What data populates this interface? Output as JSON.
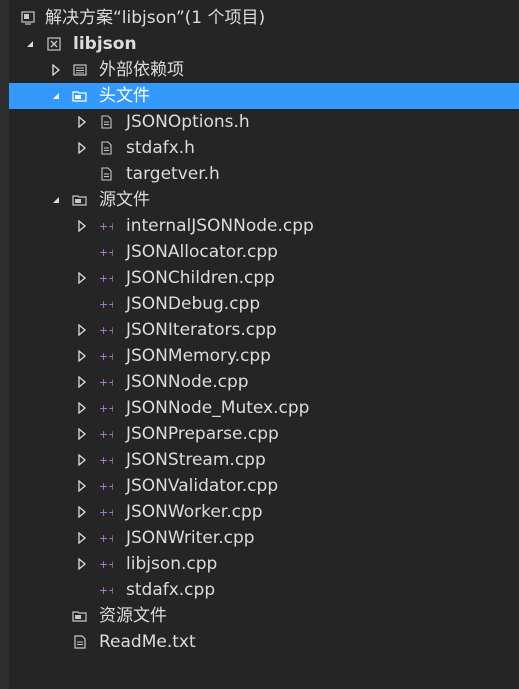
{
  "solution": {
    "label": "解决方案“libjson”(1 个项目)",
    "icon": "solution-icon"
  },
  "project": {
    "label": "libjson",
    "icon": "project-icon",
    "expanded": true
  },
  "external_deps": {
    "label": "外部依赖项",
    "icon": "external-deps-icon",
    "expanded": false
  },
  "header_folder": {
    "label": "头文件",
    "icon": "filter-folder-icon",
    "expanded": true,
    "selected": true,
    "files": [
      {
        "name": "JSONOptions.h",
        "expandable": true,
        "icon": "header-file-icon"
      },
      {
        "name": "stdafx.h",
        "expandable": true,
        "icon": "header-file-icon"
      },
      {
        "name": "targetver.h",
        "expandable": false,
        "icon": "header-file-icon"
      }
    ]
  },
  "source_folder": {
    "label": "源文件",
    "icon": "filter-folder-icon",
    "expanded": true,
    "files": [
      {
        "name": "internalJSONNode.cpp",
        "expandable": true,
        "icon": "cpp-file-icon"
      },
      {
        "name": "JSONAllocator.cpp",
        "expandable": false,
        "icon": "cpp-file-icon"
      },
      {
        "name": "JSONChildren.cpp",
        "expandable": true,
        "icon": "cpp-file-icon"
      },
      {
        "name": "JSONDebug.cpp",
        "expandable": false,
        "icon": "cpp-file-icon"
      },
      {
        "name": "JSONIterators.cpp",
        "expandable": true,
        "icon": "cpp-file-icon"
      },
      {
        "name": "JSONMemory.cpp",
        "expandable": true,
        "icon": "cpp-file-icon"
      },
      {
        "name": "JSONNode.cpp",
        "expandable": true,
        "icon": "cpp-file-icon"
      },
      {
        "name": "JSONNode_Mutex.cpp",
        "expandable": true,
        "icon": "cpp-file-icon"
      },
      {
        "name": "JSONPreparse.cpp",
        "expandable": true,
        "icon": "cpp-file-icon"
      },
      {
        "name": "JSONStream.cpp",
        "expandable": true,
        "icon": "cpp-file-icon"
      },
      {
        "name": "JSONValidator.cpp",
        "expandable": true,
        "icon": "cpp-file-icon"
      },
      {
        "name": "JSONWorker.cpp",
        "expandable": true,
        "icon": "cpp-file-icon"
      },
      {
        "name": "JSONWriter.cpp",
        "expandable": true,
        "icon": "cpp-file-icon"
      },
      {
        "name": "libjson.cpp",
        "expandable": true,
        "icon": "cpp-file-icon"
      },
      {
        "name": "stdafx.cpp",
        "expandable": false,
        "icon": "cpp-file-icon"
      }
    ]
  },
  "resource_folder": {
    "label": "资源文件",
    "icon": "filter-folder-icon",
    "expandable": false
  },
  "readme": {
    "label": "ReadMe.txt",
    "icon": "text-file-icon"
  },
  "colors": {
    "background": "#252526",
    "selection": "#3399ff",
    "text": "#dcdcdc",
    "cpp_icon": "#b080d0"
  }
}
